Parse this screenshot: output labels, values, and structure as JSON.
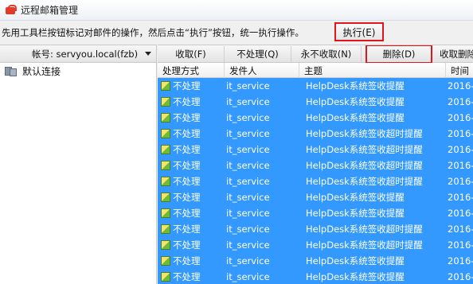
{
  "window": {
    "title": "远程邮箱管理"
  },
  "instruction": "先用工具栏按钮标记对邮件的操作，然后点击“执行”按钮，统一执行操作。",
  "execute_button": "执行(E)",
  "account": {
    "label": "帐号: servyou.local(fzb)"
  },
  "tree": [
    {
      "label": "默认连接"
    }
  ],
  "toolbar": [
    "收取(F)",
    "不处理(Q)",
    "永不收取(N)",
    "删除(D)",
    "收取删除"
  ],
  "columns": [
    "处理方式",
    "发件人",
    "主题",
    "时间"
  ],
  "rows": [
    {
      "action": "不处理",
      "sender": "it_service",
      "subject": "HelpDesk系统签收提醒",
      "time": "2016-"
    },
    {
      "action": "不处理",
      "sender": "it_service",
      "subject": "HelpDesk系统签收提醒",
      "time": "2016-"
    },
    {
      "action": "不处理",
      "sender": "it_service",
      "subject": "HelpDesk系统签收提醒",
      "time": "2016-"
    },
    {
      "action": "不处理",
      "sender": "it_service",
      "subject": "HelpDesk系统签收超时提醒",
      "time": "2016-"
    },
    {
      "action": "不处理",
      "sender": "it_service",
      "subject": "HelpDesk系统签收超时提醒",
      "time": "2016-"
    },
    {
      "action": "不处理",
      "sender": "it_service",
      "subject": "HelpDesk系统签收超时提醒",
      "time": "2016-"
    },
    {
      "action": "不处理",
      "sender": "it_service",
      "subject": "HelpDesk系统签收超时提醒",
      "time": "2016-"
    },
    {
      "action": "不处理",
      "sender": "it_service",
      "subject": "HelpDesk系统签收提醒",
      "time": "2016-"
    },
    {
      "action": "不处理",
      "sender": "it_service",
      "subject": "HelpDesk系统签收提醒",
      "time": "2016-"
    },
    {
      "action": "不处理",
      "sender": "it_service",
      "subject": "HelpDesk系统签收超时提醒",
      "time": "2016-"
    },
    {
      "action": "不处理",
      "sender": "it_service",
      "subject": "HelpDesk系统签收超时提醒",
      "time": "2016-"
    },
    {
      "action": "不处理",
      "sender": "it_service",
      "subject": "HelpDesk系统签收提醒",
      "time": "2016-"
    },
    {
      "action": "不处理",
      "sender": "it_service",
      "subject": "HelpDesk系统签收提醒",
      "time": "2016-"
    }
  ]
}
